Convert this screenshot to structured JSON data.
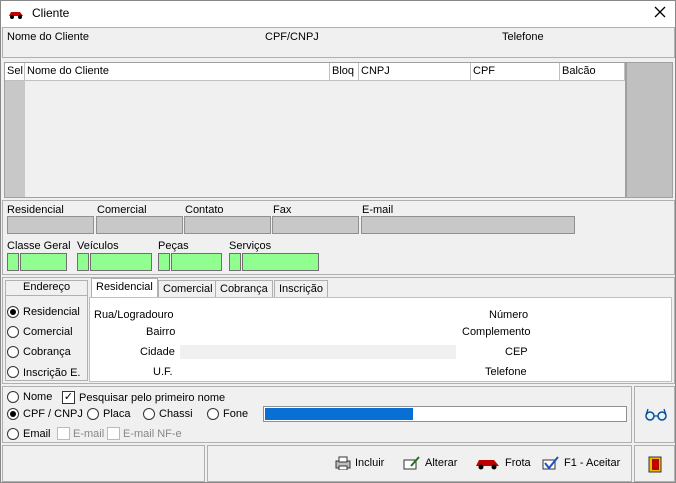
{
  "window": {
    "title": "Cliente"
  },
  "filter_header": {
    "nome_label": "Nome do Cliente",
    "cpf_cnpj_label": "CPF/CNPJ",
    "telefone_label": "Telefone"
  },
  "grid": {
    "columns": [
      "Sel",
      "Nome do Cliente",
      "Bloq",
      "CNPJ",
      "CPF",
      "Balcão"
    ]
  },
  "contacts": {
    "residencial": "Residencial",
    "comercial": "Comercial",
    "contato": "Contato",
    "fax": "Fax",
    "email": "E-mail"
  },
  "classes": {
    "classe_geral": "Classe Geral",
    "veiculos": "Veículos",
    "pecas": "Peças",
    "servicos": "Serviços"
  },
  "address": {
    "side_title": "Endereço",
    "side_options": [
      "Residencial",
      "Comercial",
      "Cobrança",
      "Inscrição E."
    ],
    "selected_index": 0,
    "tabs": [
      "Residencial",
      "Comercial",
      "Cobrança",
      "Inscrição"
    ],
    "active_tab": 0,
    "fields": {
      "rua": "Rua/Logradouro",
      "bairro": "Bairro",
      "cidade": "Cidade",
      "uf": "U.F.",
      "numero": "Número",
      "complemento": "Complemento",
      "cep": "CEP",
      "telefone": "Telefone"
    }
  },
  "search": {
    "opt_nome": "Nome",
    "first_name_check": "Pesquisar pelo primeiro nome",
    "opt_cpf": "CPF / CNPJ",
    "opt_placa": "Placa",
    "opt_chassi": "Chassi",
    "opt_fone": "Fone",
    "opt_email": "Email",
    "chk_email": "E-mail",
    "chk_email_nfe": "E-mail NF-e",
    "progress": 0.41
  },
  "actions": {
    "incluir": "Incluir",
    "alterar": "Alterar",
    "frota": "Frota",
    "aceitar": "F1 - Aceitar"
  },
  "colors": {
    "progress": "#0a6fd4",
    "green_field": "#90ff90",
    "gray_field": "#c8c8c8"
  }
}
